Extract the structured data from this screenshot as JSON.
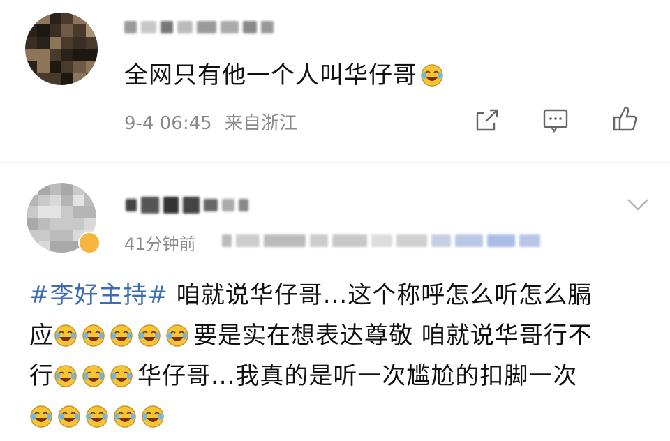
{
  "comment1": {
    "text": "全网只有他一个人叫华仔哥",
    "timestamp": "9-4 06:45",
    "location": "来自浙江"
  },
  "comment2": {
    "timestamp": "41分钟前",
    "hashtag": "#李好主持#",
    "line1_rest": " 咱就说华仔哥...这个称呼怎么听怎么膈",
    "line2_start": "应",
    "line2_end": "要是实在想表达尊敬 咱就说华哥行不",
    "line3_start": "行",
    "line3_end": "华仔哥...我真的是听一次尴尬的扣脚一次"
  },
  "icons": {
    "share": "share-icon",
    "comment": "comment-icon",
    "like": "thumbs-up-icon",
    "more": "chevron-down-icon",
    "emoji": "laugh-cry-emoji"
  },
  "colors": {
    "hashtag": "#3b6cb7",
    "meta": "#8a8a8a",
    "emoji_face": "#f7c531"
  }
}
